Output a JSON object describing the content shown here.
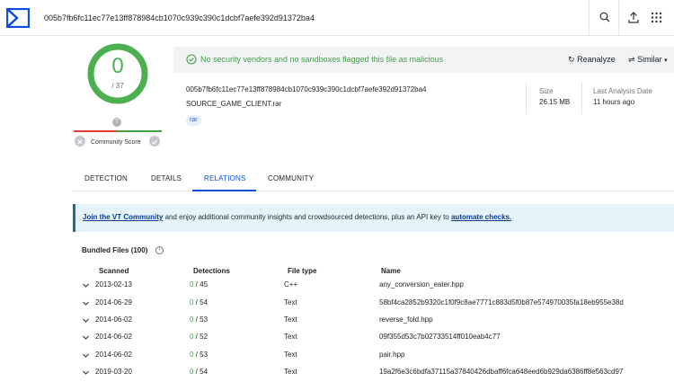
{
  "header": {
    "search_value": "005b7fb6fc11ec77e13ff878984cb1070c939c390c1dcbf7aefe392d91372ba4"
  },
  "score": {
    "detected": "0",
    "total": "/ 37",
    "community_label": "Community Score",
    "community_icon": "?"
  },
  "banner": {
    "message": "No security vendors and no sandboxes flagged this file as malicious",
    "reanalyze": "Reanalyze",
    "similar": "Similar"
  },
  "file": {
    "hash": "005b7fb6fc11ec77e13ff878984cb1070c939c390c1dcbf7aefe392d91372ba4",
    "name": "SOURCE_GAME_CLIENT.rar",
    "tag": "rar",
    "size_label": "Size",
    "size_value": "26.15 MB",
    "last_analysis_label": "Last Analysis Date",
    "last_analysis_value": "11 hours ago"
  },
  "tabs": [
    "DETECTION",
    "DETAILS",
    "RELATIONS",
    "COMMUNITY"
  ],
  "active_tab": "RELATIONS",
  "info": {
    "link1": "Join the VT Community",
    "middle": " and enjoy additional community insights and crowdsourced detections, plus an API key to ",
    "link2": "automate checks."
  },
  "bundled": {
    "title": "Bundled Files",
    "count": "(100)",
    "columns": [
      "Scanned",
      "Detections",
      "File type",
      "Name"
    ],
    "rows": [
      {
        "scanned": "2013-02-13",
        "det": "0",
        "det_total": " / 45",
        "type": "C++",
        "name": "any_conversion_eater.hpp"
      },
      {
        "scanned": "2014-06-29",
        "det": "0",
        "det_total": " / 54",
        "type": "Text",
        "name": "58bf4ca2852b9320c1f0f9c8ae7771c883d5f0b87e574970035fa18eb955e38d"
      },
      {
        "scanned": "2014-06-02",
        "det": "0",
        "det_total": " / 53",
        "type": "Text",
        "name": "reverse_fold.hpp"
      },
      {
        "scanned": "2014-06-02",
        "det": "0",
        "det_total": " / 52",
        "type": "Text",
        "name": "09f355d53c7b02733514ff010eab4c77"
      },
      {
        "scanned": "2014-06-02",
        "det": "0",
        "det_total": " / 53",
        "type": "Text",
        "name": "pair.hpp"
      },
      {
        "scanned": "2019-03-20",
        "det": "0",
        "det_total": " / 54",
        "type": "Text",
        "name": "19a2f6e3c6bdfa37115a37840426dbaff6fca648eed6b929da6386ff8e563cd97"
      }
    ]
  },
  "colors": {
    "accent": "#0b4dda",
    "success": "#43a047",
    "danger": "#e53935"
  }
}
